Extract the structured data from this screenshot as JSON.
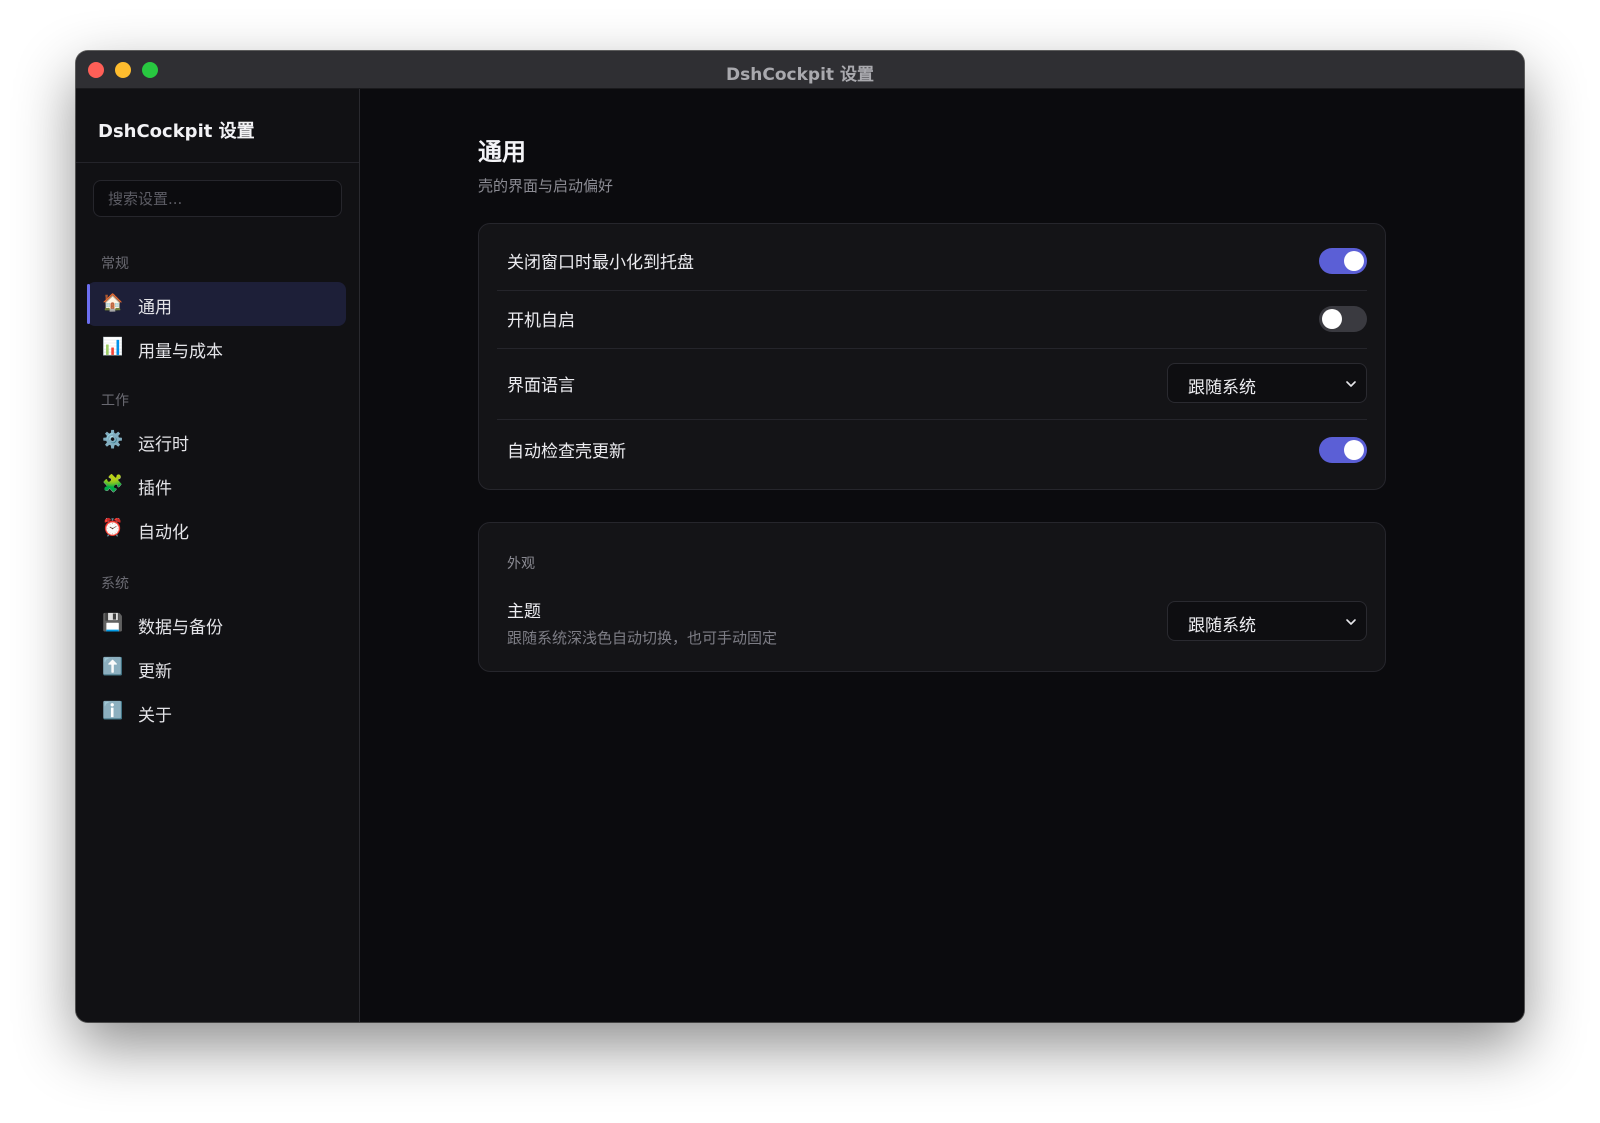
{
  "window": {
    "title": "DshCockpit 设置"
  },
  "sidebar": {
    "brand": "DshCockpit 设置",
    "search_placeholder": "搜索设置...",
    "sections": [
      {
        "label": "常规",
        "items": [
          {
            "label": "通用",
            "icon": "house-icon",
            "active": true
          },
          {
            "label": "用量与成本",
            "icon": "bar-chart-icon",
            "active": false
          }
        ]
      },
      {
        "label": "工作",
        "items": [
          {
            "label": "运行时",
            "icon": "gear-icon",
            "active": false
          },
          {
            "label": "插件",
            "icon": "puzzle-icon",
            "active": false
          },
          {
            "label": "自动化",
            "icon": "alarm-clock-icon",
            "active": false
          }
        ]
      },
      {
        "label": "系统",
        "items": [
          {
            "label": "数据与备份",
            "icon": "floppy-disk-icon",
            "active": false
          },
          {
            "label": "更新",
            "icon": "up-arrow-icon",
            "active": false
          },
          {
            "label": "关于",
            "icon": "info-icon",
            "active": false
          }
        ]
      }
    ]
  },
  "main": {
    "title": "通用",
    "subtitle": "壳的界面与启动偏好",
    "general_card": {
      "rows": [
        {
          "label": "关闭窗口时最小化到托盘",
          "control": "toggle",
          "on": true
        },
        {
          "label": "开机自启",
          "control": "toggle",
          "on": false
        },
        {
          "label": "界面语言",
          "control": "select",
          "value": "跟随系统"
        },
        {
          "label": "自动检查壳更新",
          "control": "toggle",
          "on": true
        }
      ]
    },
    "appearance_card": {
      "group_label": "外观",
      "theme": {
        "label": "主题",
        "description": "跟随系统深浅色自动切换，也可手动固定",
        "value": "跟随系统"
      }
    }
  },
  "colors": {
    "accent": "#5b5fd6",
    "window_bg": "#0b0b0e",
    "sidebar_bg": "#111114",
    "card_bg": "#141417",
    "active_nav_bg": "#1d1f38"
  }
}
